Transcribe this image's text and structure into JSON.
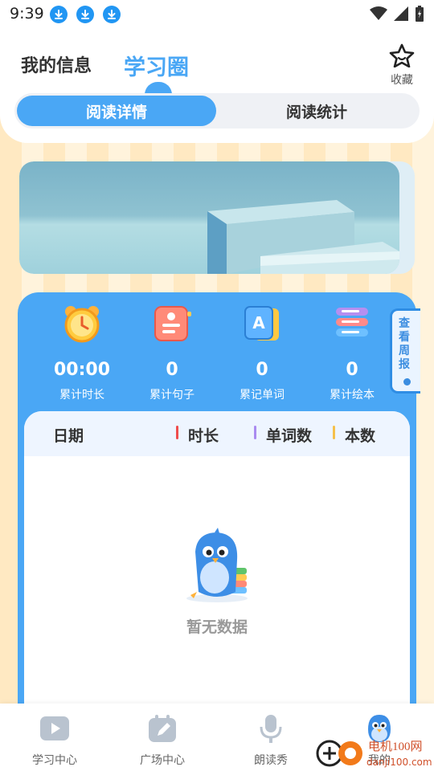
{
  "status_bar": {
    "time": "9:39"
  },
  "header": {
    "tab_my_info": "我的信息",
    "tab_study_circle": "学习圈",
    "favorite_label": "收藏",
    "segments": {
      "active": "阅读详情",
      "inactive": "阅读统计"
    }
  },
  "stats": {
    "items": [
      {
        "value": "00:00",
        "label": "累计时长",
        "icon": "alarm-clock-icon"
      },
      {
        "value": "0",
        "label": "累计句子",
        "icon": "sentence-card-icon"
      },
      {
        "value": "0",
        "label": "累记单词",
        "icon": "word-card-icon"
      },
      {
        "value": "0",
        "label": "累计绘本",
        "icon": "book-stack-icon"
      }
    ],
    "weekly_report": "查看周报"
  },
  "table": {
    "columns": [
      "日期",
      "时长",
      "单词数",
      "本数"
    ],
    "empty_text": "暂无数据"
  },
  "bottom_nav": {
    "items": [
      {
        "label": "学习中心",
        "icon": "play-icon"
      },
      {
        "label": "广场中心",
        "icon": "pencil-calendar-icon"
      },
      {
        "label": "朗读秀",
        "icon": "microphone-icon"
      },
      {
        "label": "我的",
        "icon": "bird-mascot-icon"
      }
    ]
  },
  "watermark": {
    "text": "电机100网",
    "url": "danji100.com"
  },
  "colors": {
    "accent": "#4aa7f5",
    "duration_bar": "#ef4d4d",
    "words_bar": "#a98bf0",
    "count_bar": "#f5c04a",
    "background_stripe": "#ffe9c2"
  }
}
